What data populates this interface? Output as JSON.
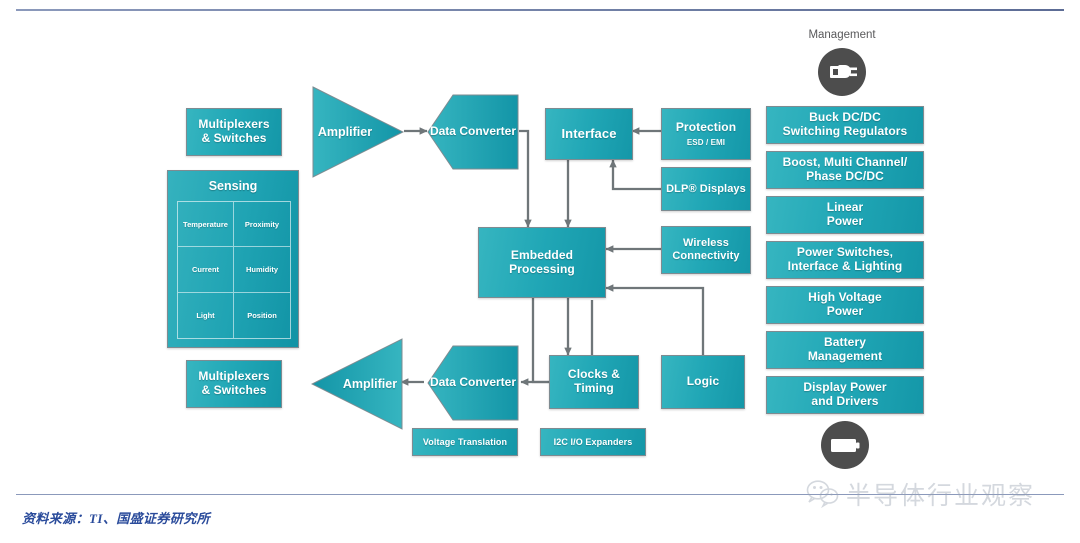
{
  "diagram": {
    "title": "TI System Block Diagram",
    "accent_color": "#21a7b6",
    "connector_color": "#6f7679",
    "icon_color": "#4d4d4d",
    "footer_color": "#2a4b9b"
  },
  "signal_chain_top": {
    "mux_label": "Multiplexers\n& Switches",
    "mux_line1": "Multiplexers",
    "mux_line2": "& Switches",
    "amplifier_label": "Amplifier",
    "data_converter_line1": "Data",
    "data_converter_line2": "Converter"
  },
  "signal_chain_bottom": {
    "mux_line1": "Multiplexers",
    "mux_line2": "& Switches",
    "amplifier_label": "Amplifier",
    "data_converter_line1": "Data",
    "data_converter_line2": "Converter"
  },
  "sensing": {
    "title": "Sensing",
    "cells": [
      "Temperature",
      "Proximity",
      "Current",
      "Humidity",
      "Light",
      "Position"
    ]
  },
  "core": {
    "interface_label": "Interface",
    "embedded_line1": "Embedded",
    "embedded_line2": "Processing",
    "clocks_line1": "Clocks &",
    "clocks_line2": "Timing",
    "logic_label": "Logic"
  },
  "peripherals": {
    "protection_title": "Protection",
    "protection_sub": "ESD / EMI",
    "dlp_label": "DLP® Displays",
    "wireless_line1": "Wireless",
    "wireless_line2": "Connectivity",
    "voltage_translation": "Voltage Translation",
    "i2c_expanders": "I2C I/O Expanders"
  },
  "power": {
    "management_label": "Management",
    "plug_icon": "plug-icon",
    "battery_icon": "battery-icon",
    "blocks": [
      {
        "line1": "Buck DC/DC",
        "line2": "Switching Regulators"
      },
      {
        "line1": "Boost, Multi Channel/",
        "line2": "Phase DC/DC"
      },
      {
        "line1": "Linear",
        "line2": "Power"
      },
      {
        "line1": "Power Switches,",
        "line2": "Interface & Lighting"
      },
      {
        "line1": "High Voltage",
        "line2": "Power"
      },
      {
        "line1": "Battery",
        "line2": "Management"
      },
      {
        "line1": "Display Power",
        "line2": "and Drivers"
      }
    ]
  },
  "footer": {
    "source_prefix": "资料来源：",
    "source_company": "TI",
    "source_suffix": "、国盛证券研究所",
    "source_full": "资料来源：TI、国盛证券研究所"
  },
  "watermark": {
    "text": "半导体行业观察",
    "icon": "wechat-icon"
  }
}
